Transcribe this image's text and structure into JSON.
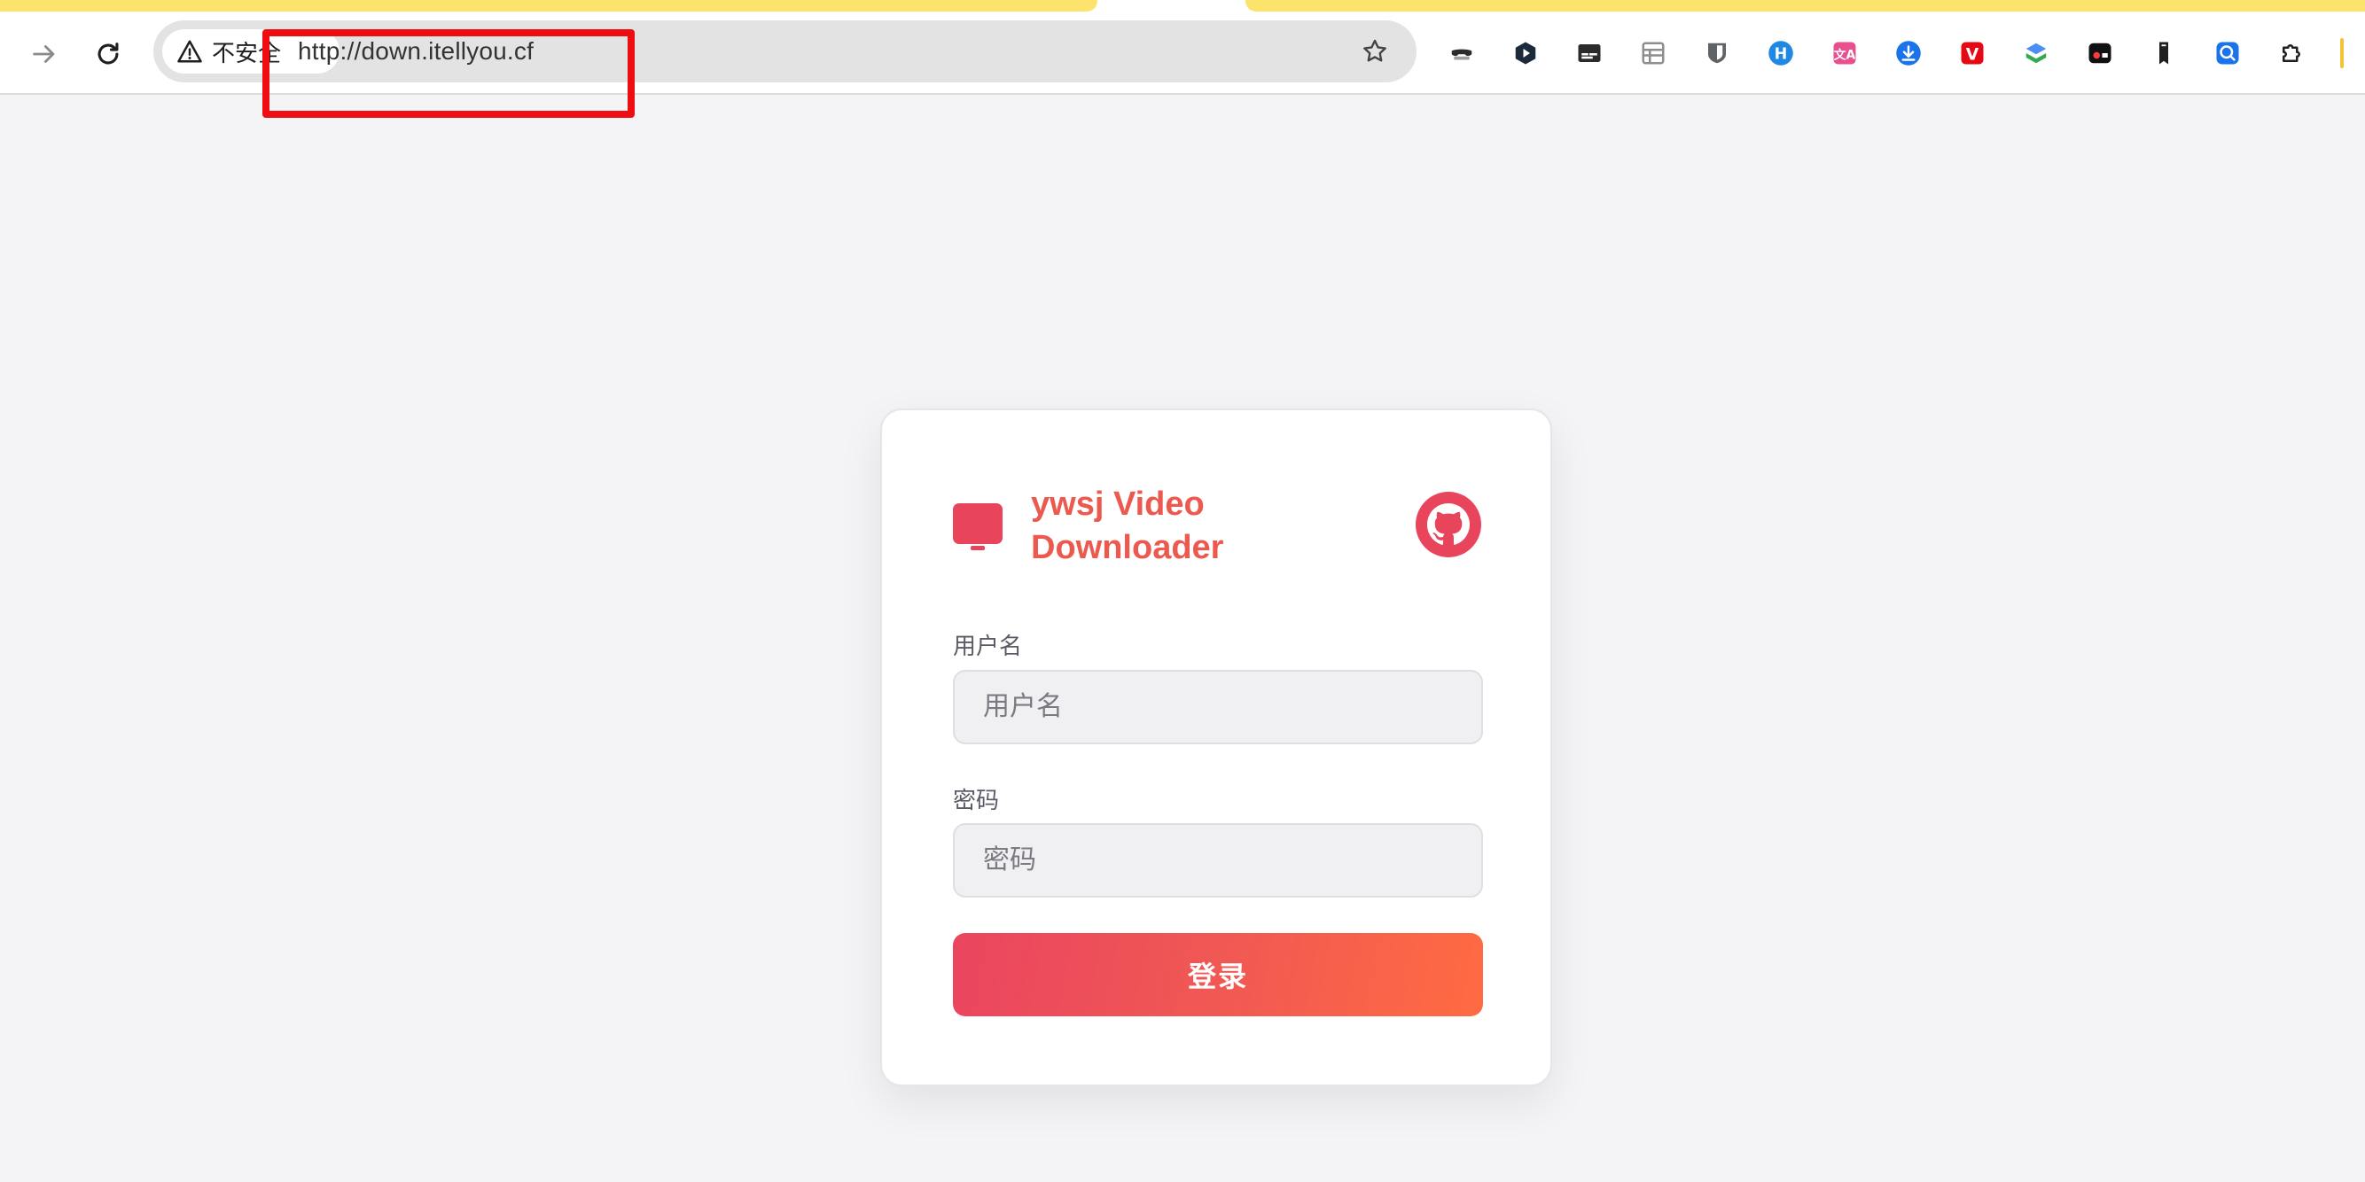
{
  "browser": {
    "security_label": "不安全",
    "url": "http://down.itellyou.cf",
    "colors": {
      "tab_accent": "#fbe36c",
      "highlight": "#ef0d12"
    },
    "extensions": [
      {
        "icon": "spy-mask-icon",
        "bg": "#ffffff",
        "fg": "#2b2b2b"
      },
      {
        "icon": "cube-play-icon",
        "bg": "#1b2b3c",
        "fg": "#ffffff"
      },
      {
        "icon": "subtitle-icon",
        "bg": "#2b2b2b",
        "fg": "#ffffff"
      },
      {
        "icon": "table-icon",
        "bg": "#8e8e8e",
        "fg": "#ffffff"
      },
      {
        "icon": "bitwarden-icon",
        "bg": "#5f6368",
        "fg": "#ffffff"
      },
      {
        "icon": "h-icon",
        "bg": "#1e88e5",
        "fg": "#ffffff"
      },
      {
        "icon": "translate-icon",
        "bg": "#e84f8f",
        "fg": "#ffffff"
      },
      {
        "icon": "download-icon",
        "bg": "#1a73e8",
        "fg": "#ffffff"
      },
      {
        "icon": "v-icon",
        "bg": "#e50914",
        "fg": "#ffffff"
      },
      {
        "icon": "layers-icon",
        "bg": "#4c8df6",
        "fg": "#ffffff"
      },
      {
        "icon": "record-icon",
        "bg": "#111111",
        "fg": "#ff3b3b"
      },
      {
        "icon": "bookmark-tag-icon",
        "bg": "#ffffff",
        "fg": "#1f1f1f"
      },
      {
        "icon": "search-q-icon",
        "bg": "#1a73e8",
        "fg": "#ffffff"
      },
      {
        "icon": "puzzle-icon",
        "bg": "#ffffff",
        "fg": "#1f1f1f"
      }
    ]
  },
  "login": {
    "brand_title": "ywsj Video Downloader",
    "username_label": "用户名",
    "username_placeholder": "用户名",
    "password_label": "密码",
    "password_placeholder": "密码",
    "submit_label": "登录",
    "colors": {
      "brand": "#e8455d",
      "gradient_start": "#ea4560",
      "gradient_end": "#ff6b42"
    }
  }
}
